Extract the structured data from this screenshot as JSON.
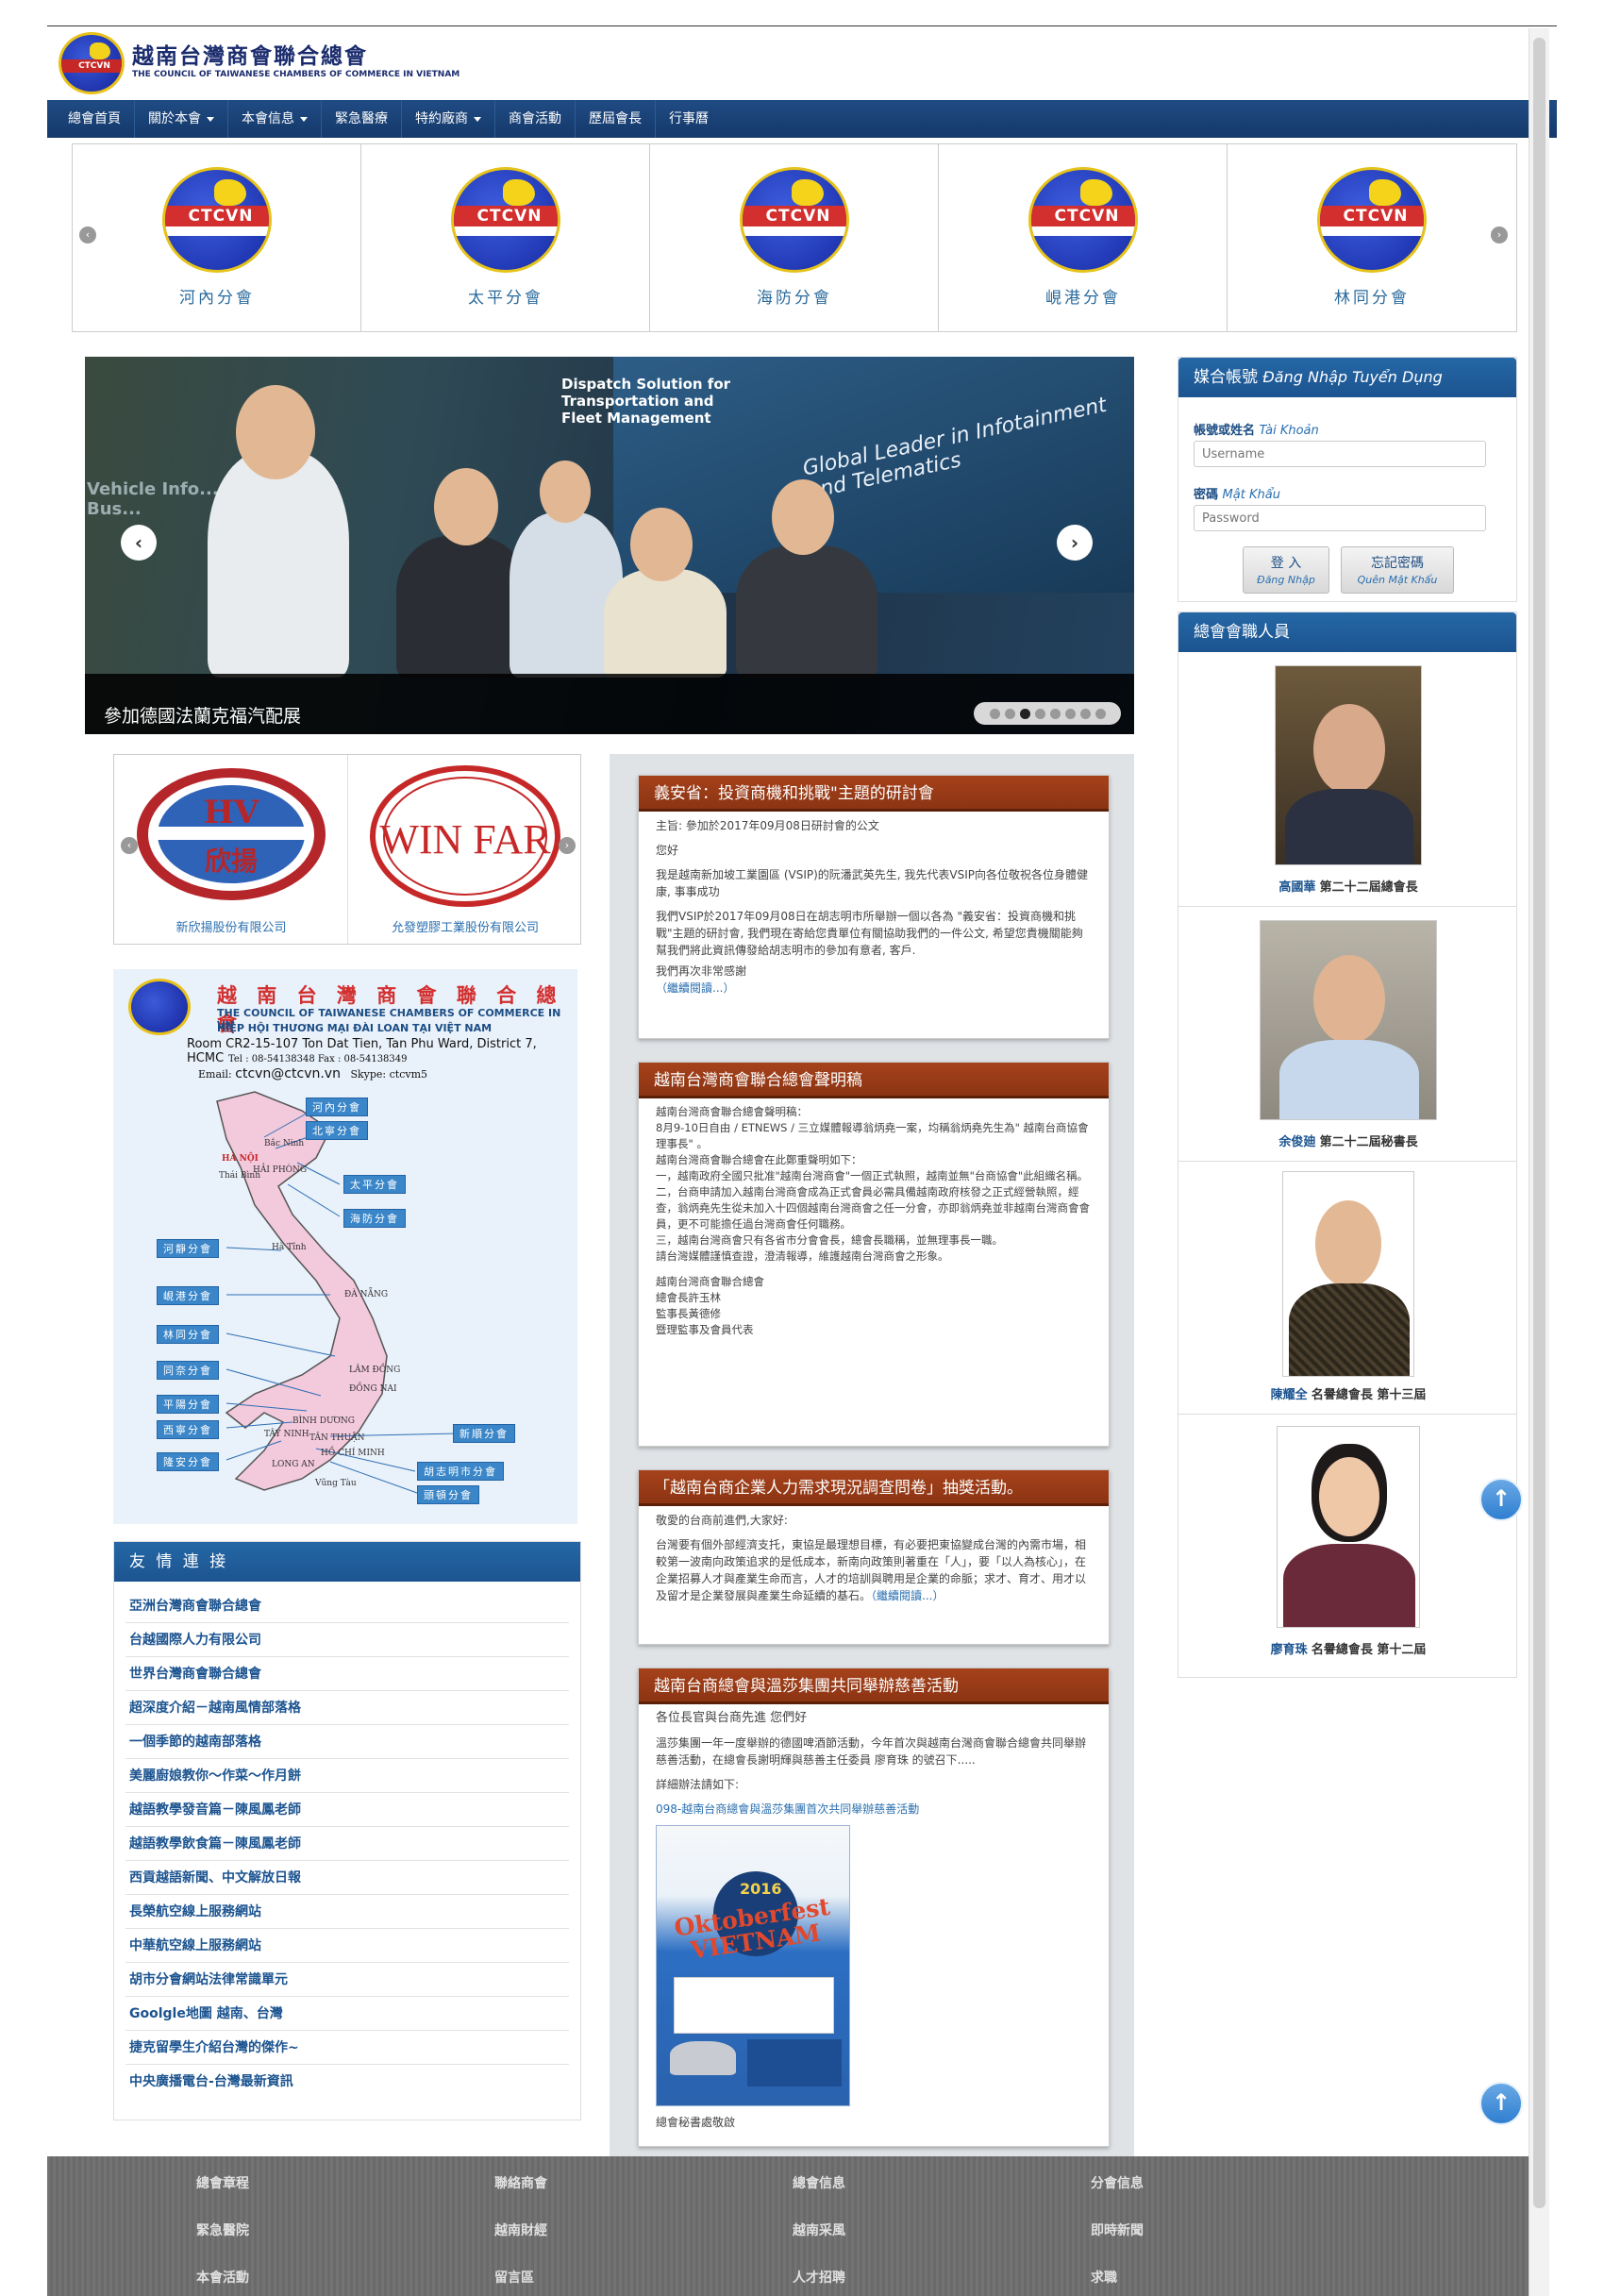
{
  "header": {
    "title": "越南台灣商會聯合總會",
    "subtitle": "THE COUNCIL OF TAIWANESE CHAMBERS OF COMMERCE IN VIETNAM",
    "logo_text": "CTCVN"
  },
  "nav": [
    {
      "label": "總會首頁",
      "dropdown": false
    },
    {
      "label": "關於本會",
      "dropdown": true
    },
    {
      "label": "本會信息",
      "dropdown": true
    },
    {
      "label": "緊急醫療",
      "dropdown": false
    },
    {
      "label": "特約廠商",
      "dropdown": true
    },
    {
      "label": "商會活動",
      "dropdown": false
    },
    {
      "label": "歷屆會長",
      "dropdown": false
    },
    {
      "label": "行事曆",
      "dropdown": false
    }
  ],
  "branches": [
    {
      "label": "河內分會"
    },
    {
      "label": "太平分會"
    },
    {
      "label": "海防分會"
    },
    {
      "label": "峴港分會"
    },
    {
      "label": "林同分會"
    }
  ],
  "slider": {
    "caption": "參加德國法蘭克福汽配展",
    "text_dispatch": "Dispatch Solution for Transportation and Fleet Management",
    "text_leader": "Global Leader in Infotainment and Telematics",
    "text_vehicle": "Vehicle Info... Solution for Bus...",
    "dots": 8,
    "active_dot": 3
  },
  "login": {
    "title": "媒合帳號",
    "title_vn": "Đăng Nhập Tuyển Dụng",
    "user_label": "帳號或姓名",
    "user_label_vn": "Tài Khoản",
    "user_placeholder": "Username",
    "pass_label": "密碼",
    "pass_label_vn": "Mật Khẩu",
    "pass_placeholder": "Password",
    "login_btn": "登 入",
    "login_btn_vn": "Đăng Nhập",
    "forgot_btn": "忘記密碼",
    "forgot_btn_vn": "Quên Mật Khẩu"
  },
  "members": {
    "title": "總會會職人員",
    "items": [
      {
        "name": "高國華",
        "role": "第二十二屆總會長"
      },
      {
        "name": "余俊廸",
        "role": "第二十二屆秘書長"
      },
      {
        "name": "陳耀全",
        "role": "名譽總會長 第十三屆"
      },
      {
        "name": "廖育珠",
        "role": "名譽總會長 第十二屆"
      }
    ]
  },
  "partners": [
    {
      "label": "新欣揚股份有限公司",
      "logo_top": "HV",
      "logo_bottom": "欣揚"
    },
    {
      "label": "允發塑膠工業股份有限公司",
      "logo_top": "WIN FAR"
    }
  ],
  "map": {
    "title": "越 南 台 灣 商 會 聯 合 總 會",
    "en": "THE COUNCIL OF TAIWANESE CHAMBERS OF COMMERCE IN VN",
    "vn": "HIỆP HỘI THƯƠNG MẠI ĐÀI LOAN TẠI VIỆT NAM",
    "address": "Room CR2-15-107 Ton Dat Tien, Tan Phu Ward, District 7, HCMC",
    "tel": "Tel : 08-54138348    Fax : 08-54138349",
    "email_label": "Email:",
    "email": "ctcvn@ctcvn.vn",
    "skype": "Skype: ctcvm5",
    "tags": [
      "河內分會",
      "北寧分會",
      "太平分會",
      "海防分會",
      "河靜分會",
      "峴港分會",
      "林同分會",
      "同奈分會",
      "平陽分會",
      "西寧分會",
      "隆安分會",
      "新順分會",
      "胡志明市分會",
      "頭頓分會"
    ],
    "places": [
      "HÀ NỘI",
      "Bắc Ninh",
      "HẢI PHÒNG",
      "Thái Bình",
      "Hà Tĩnh",
      "ĐÀ NẴNG",
      "LÂM ĐỒNG",
      "ĐỒNG NAI",
      "BÌNH DƯƠNG",
      "TÂY NINH",
      "TÂN THUẬN",
      "LONG AN",
      "HỒ CHÍ MINH",
      "Vũng Tàu"
    ]
  },
  "links": {
    "title": "友 情 連 接",
    "items": [
      "亞洲台灣商會聯合總會",
      "台越國際人力有限公司",
      "世界台灣商會聯合總會",
      "超深度介紹－越南風情部落格",
      "一個季節的越南部落格",
      "美麗廚娘教你～作菜～作月餅",
      "越語教學發音篇－陳風鳳老師",
      "越語教學飲食篇－陳風鳳老師",
      "西貢越語新聞、中文解放日報",
      "長榮航空線上服務網站",
      "中華航空線上服務網站",
      "胡市分會網站法律常識單元",
      "Goolgle地圖 越南、台灣",
      "捷克留學生介紹台灣的傑作~",
      "中央廣播電台-台灣最新資訊"
    ]
  },
  "news": [
    {
      "title": "義安省：投資商機和挑戰\"主題的研討會",
      "paras": [
        "主旨: 參加於2017年09月08日研討會的公文",
        "您好",
        "我是越南新加坡工業園區 (VSIP)的阮潘武英先生, 我先代表VSIP向各位敬祝各位身體健康, 事事成功",
        "我們VSIP於2017年09月08日在胡志明市所舉辦一個以各為 \"義安省：投資商機和挑戰\"主題的研討會, 我們現在寄給您貴單位有關協助我們的一件公文, 希望您貴機關能夠幫我們將此資訊傳發給胡志明市的參加有意者, 客戶.",
        "我們再次非常感謝"
      ],
      "more": "（繼續閱讀...）"
    },
    {
      "title": "越南台灣商會聯合總會聲明稿",
      "paras": [
        "越南台灣商會聯合總會聲明稿：",
        "8月9-10日自由 / ETNEWS / 三立媒體報導翁炳堯一案，均稱翁炳堯先生為\" 越南台商協會理事長\" 。",
        "越南台灣商會聯合總會在此鄭重聲明如下：",
        "一，越南政府全國只批准\"越南台灣商會\"一個正式執照，越南並無\"台商協會\"此組織名稱。",
        "二，台商申請加入越南台灣商會成為正式會員必需具備越南政府核發之正式經營執照，經查，翁炳堯先生從未加入十四個越南台灣商會之任一分會，亦即翁炳堯並非越南台灣商會會員，更不可能擔任過台灣商會任何職務。",
        "三，越南台灣商會只有各省市分會會長，總會長職稱，並無理事長一職。",
        "請台灣媒體謹慎查證，澄清報導，維護越南台灣商會之形象。",
        "越南台灣商會聯合總會",
        "總會長許玉林",
        "監事長黃德修",
        "暨理監事及會員代表"
      ],
      "more": ""
    },
    {
      "title": "「越南台商企業人力需求現況調查問卷」抽獎活動。",
      "paras": [
        "敬愛的台商前進們,大家好:",
        "台灣要有個外部經濟支托，東協是最理想目標，有必要把東協變成台灣的內需市場，相較第一波南向政策追求的是低成本，新南向政策則著重在「人」，要「以人為核心」，在企業招募人才與產業生命而言，人才的培訓與聘用是企業的命脈；求才、育才、用才以及留才是企業發展與產業生命延續的基石。"
      ],
      "more": "（繼續閱讀...）"
    },
    {
      "title": "越南台商總會與溫莎集團共同舉辦慈善活動",
      "paras": [
        "各位長官與台商先進 您們好",
        "溫莎集團一年一度舉辦的德國啤酒節活動，今年首次與越南台灣商會聯合總會共同舉辦慈善活動，在總會長謝明輝與慈善主任委員 廖育珠 的號召下.....",
        "詳細辦法請如下:"
      ],
      "link": "098-越南台商總會與溫莎集團首次共同舉辦慈善活動",
      "poster_text": "Oktoberfest VIETNAM",
      "poster_year": "2016",
      "sign": "總會秘書處敬啟",
      "more": ""
    }
  ],
  "footer": [
    [
      "總會章程",
      "聯絡商會",
      "總會信息",
      "分會信息"
    ],
    [
      "緊急醫院",
      "越南財經",
      "越南采風",
      "即時新聞"
    ],
    [
      "本會活動",
      "留言區",
      "人才招聘",
      "求職"
    ]
  ]
}
